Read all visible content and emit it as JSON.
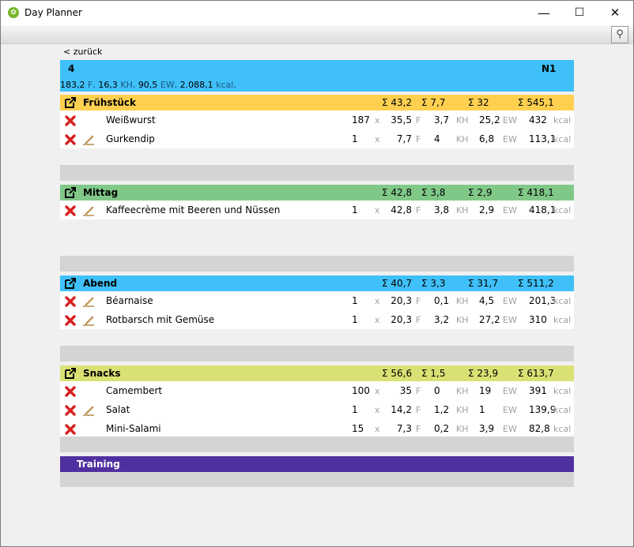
{
  "window": {
    "title": "Day Planner",
    "min": "—",
    "max": "☐",
    "close": "✕"
  },
  "nav": {
    "back": "< zurück"
  },
  "day": {
    "number": "4",
    "code": "N1",
    "fat": "183,2",
    "fat_lbl": "F,",
    "kh": "16,3",
    "kh_lbl": "KH,",
    "ew": "90,5",
    "ew_lbl": "EW,",
    "kcal": "2.088,1",
    "kcal_lbl": "kcal,"
  },
  "colors": {
    "day": "#40c0f8",
    "fruehstueck": "#ffd050",
    "mittag": "#80c888",
    "abend": "#40c0f8",
    "snacks": "#dae174",
    "training": "#5030a0"
  },
  "meals": [
    {
      "name": "Frühstück",
      "sum_f": "Σ 43,2",
      "sum_kh": "Σ 7,7",
      "sum_ew": "Σ 32",
      "sum_kcal": "Σ 545,1",
      "items": [
        {
          "name": "Weißwurst",
          "qty": "187",
          "x": "x",
          "f": "35,5",
          "fl": "F",
          "kh": "3,7",
          "khl": "KH",
          "ew": "25,2",
          "ewl": "EW",
          "kcal": "432",
          "kl": "kcal",
          "edit": false
        },
        {
          "name": "Gurkendip",
          "qty": "1",
          "x": "x",
          "f": "7,7",
          "fl": "F",
          "kh": "4",
          "khl": "KH",
          "ew": "6,8",
          "ewl": "EW",
          "kcal": "113,1",
          "kl": "kcal",
          "edit": true
        }
      ]
    },
    {
      "name": "Mittag",
      "sum_f": "Σ 42,8",
      "sum_kh": "Σ 3,8",
      "sum_ew": "Σ 2,9",
      "sum_kcal": "Σ 418,1",
      "items": [
        {
          "name": "Kaffeecrème mit Beeren und Nüssen",
          "qty": "1",
          "x": "x",
          "f": "42,8",
          "fl": "F",
          "kh": "3,8",
          "khl": "KH",
          "ew": "2,9",
          "ewl": "EW",
          "kcal": "418,1",
          "kl": "kcal",
          "edit": true
        }
      ]
    },
    {
      "name": "Abend",
      "sum_f": "Σ 40,7",
      "sum_kh": "Σ 3,3",
      "sum_ew": "Σ 31,7",
      "sum_kcal": "Σ 511,2",
      "items": [
        {
          "name": "Béarnaise",
          "qty": "1",
          "x": "x",
          "f": "20,3",
          "fl": "F",
          "kh": "0,1",
          "khl": "KH",
          "ew": "4,5",
          "ewl": "EW",
          "kcal": "201,3",
          "kl": "kcal",
          "edit": true
        },
        {
          "name": "Rotbarsch mit Gemüse",
          "qty": "1",
          "x": "x",
          "f": "20,3",
          "fl": "F",
          "kh": "3,2",
          "khl": "KH",
          "ew": "27,2",
          "ewl": "EW",
          "kcal": "310",
          "kl": "kcal",
          "edit": true
        }
      ]
    },
    {
      "name": "Snacks",
      "sum_f": "Σ 56,6",
      "sum_kh": "Σ 1,5",
      "sum_ew": "Σ 23,9",
      "sum_kcal": "Σ 613,7",
      "items": [
        {
          "name": "Camembert",
          "qty": "100",
          "x": "x",
          "f": "35",
          "fl": "F",
          "kh": "0",
          "khl": "KH",
          "ew": "19",
          "ewl": "EW",
          "kcal": "391",
          "kl": "kcal",
          "edit": false
        },
        {
          "name": "Salat",
          "qty": "1",
          "x": "x",
          "f": "14,2",
          "fl": "F",
          "kh": "1,2",
          "khl": "KH",
          "ew": "1",
          "ewl": "EW",
          "kcal": "139,9",
          "kl": "kcal",
          "edit": true
        },
        {
          "name": "Mini-Salami",
          "qty": "15",
          "x": "x",
          "f": "7,3",
          "fl": "F",
          "kh": "0,2",
          "khl": "KH",
          "ew": "3,9",
          "ewl": "EW",
          "kcal": "82,8",
          "kl": "kcal",
          "edit": false
        }
      ]
    }
  ],
  "training": {
    "name": "Training"
  }
}
